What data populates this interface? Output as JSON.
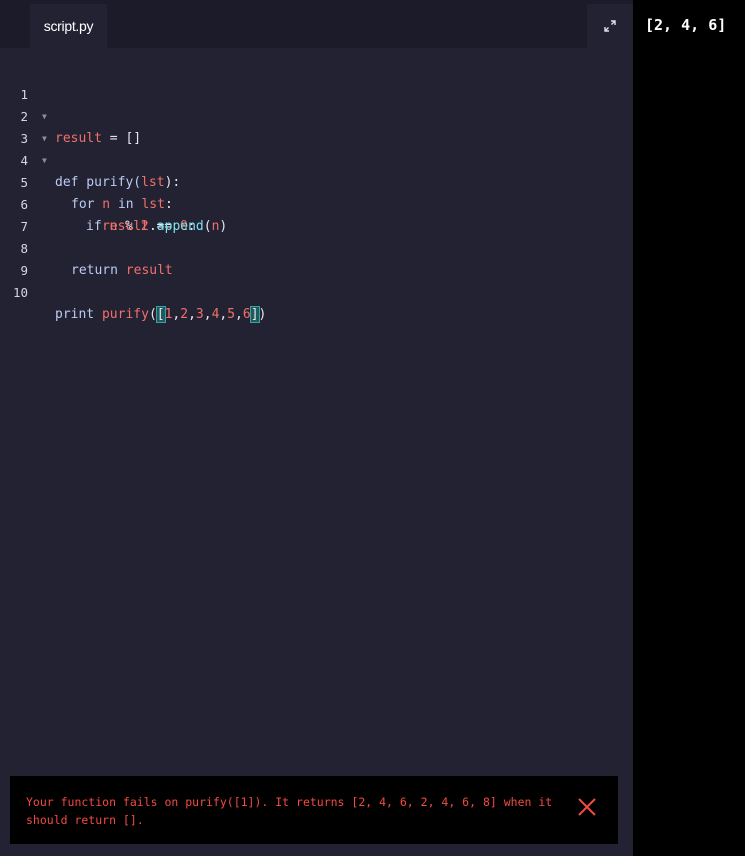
{
  "editor": {
    "tab_label": "script.py",
    "expand_icon": "expand-icon",
    "lines": [
      {
        "n": "1"
      },
      {
        "n": "2"
      },
      {
        "n": "3"
      },
      {
        "n": "4"
      },
      {
        "n": "5"
      },
      {
        "n": "6"
      },
      {
        "n": "7"
      },
      {
        "n": "8"
      },
      {
        "n": "9"
      },
      {
        "n": "10"
      }
    ],
    "code": {
      "l2_var": "result",
      "l2_rest": " = []",
      "l3_def": "def",
      "l3_name": " purify(",
      "l3_param": "lst",
      "l3_end": "):",
      "l4_for": "for",
      "l4_n": " n ",
      "l4_in": "in",
      "l4_lst": " lst",
      "l4_end": ":",
      "l5_if": "if",
      "l5_n": " n",
      "l5_mod": " % ",
      "l5_two": "2",
      "l5_eq": " == ",
      "l5_zero": "0",
      "l5_end": ":",
      "l6_obj": "result",
      "l6_dot": ".",
      "l6_method": "append",
      "l6_open": "(",
      "l6_arg": "n",
      "l6_close": ")",
      "l8_ret": "return",
      "l8_val": " result",
      "l10_print": "print",
      "l10_fn": " purify",
      "l10_paren_open": "(",
      "l10_lbracket": "[",
      "l10_n1": "1",
      "l10_c1": ",",
      "l10_n2": "2",
      "l10_c2": ",",
      "l10_n3": "3",
      "l10_c3": ",",
      "l10_n4": "4",
      "l10_c4": ",",
      "l10_n5": "5",
      "l10_c5": ",",
      "l10_n6": "6",
      "l10_rbracket": "]",
      "l10_paren_close": ")"
    }
  },
  "output": {
    "text": "[2, 4, 6]"
  },
  "error": {
    "message": "Your function fails on purify([1]). It returns [2, 4, 6, 2, 4, 6, 8] when it should return [].",
    "close_icon": "close-icon",
    "color": "#f24b3f"
  }
}
